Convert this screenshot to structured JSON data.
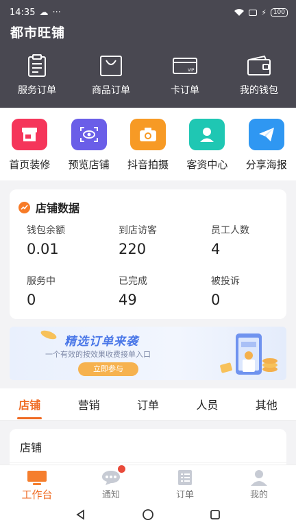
{
  "status": {
    "time": "14:35",
    "battery": "100"
  },
  "app_title": "都市旺铺",
  "quick_actions": [
    {
      "label": "服务订单",
      "icon": "clipboard-icon"
    },
    {
      "label": "商品订单",
      "icon": "shopping-bag-icon"
    },
    {
      "label": "卡订单",
      "icon": "vip-card-icon"
    },
    {
      "label": "我的钱包",
      "icon": "wallet-icon"
    }
  ],
  "tools": [
    {
      "label": "首页装修",
      "icon": "storefront-icon",
      "color": "#f5355a"
    },
    {
      "label": "预览店铺",
      "icon": "eye-scan-icon",
      "color": "#6a5ee8"
    },
    {
      "label": "抖音拍摄",
      "icon": "camera-icon",
      "color": "#f79a25"
    },
    {
      "label": "客资中心",
      "icon": "person-icon",
      "color": "#1fc7b3"
    },
    {
      "label": "分享海报",
      "icon": "paper-plane-icon",
      "color": "#2f97f2"
    }
  ],
  "store_data": {
    "title": "店铺数据",
    "stats": [
      {
        "label": "钱包余额",
        "value": "0.01"
      },
      {
        "label": "到店访客",
        "value": "220"
      },
      {
        "label": "员工人数",
        "value": "4"
      },
      {
        "label": "服务中",
        "value": "0"
      },
      {
        "label": "已完成",
        "value": "49"
      },
      {
        "label": "被投诉",
        "value": "0"
      }
    ]
  },
  "banner": {
    "title": "精选订单来袭",
    "subtitle": "一个有效的按效果收费接单入口",
    "button": "立即参与"
  },
  "tabs": [
    "店铺",
    "营销",
    "订单",
    "人员",
    "其他"
  ],
  "section_title": "店铺",
  "bottom_nav": [
    {
      "label": "工作台",
      "icon": "monitor-icon"
    },
    {
      "label": "通知",
      "icon": "chat-bubble-icon"
    },
    {
      "label": "订单",
      "icon": "list-icon"
    },
    {
      "label": "我的",
      "icon": "user-icon"
    }
  ],
  "colors": {
    "header_bg": "#494851",
    "accent": "#ef6a22"
  }
}
